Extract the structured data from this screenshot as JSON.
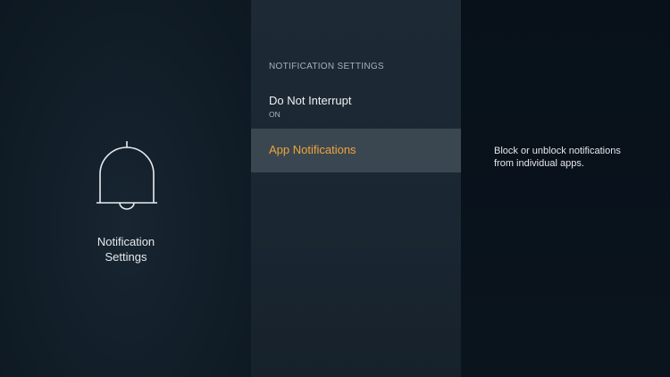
{
  "left": {
    "icon": "bell-icon",
    "title": "Notification\nSettings"
  },
  "menu": {
    "header": "NOTIFICATION SETTINGS",
    "items": [
      {
        "label": "Do Not Interrupt",
        "value": "ON",
        "selected": false
      },
      {
        "label": "App Notifications",
        "value": "",
        "selected": true
      }
    ]
  },
  "right": {
    "description": "Block or unblock notifications\nfrom individual apps."
  },
  "colors": {
    "accent": "#f0a43a",
    "selection": "#3a4751",
    "text": "#eef1f3"
  }
}
